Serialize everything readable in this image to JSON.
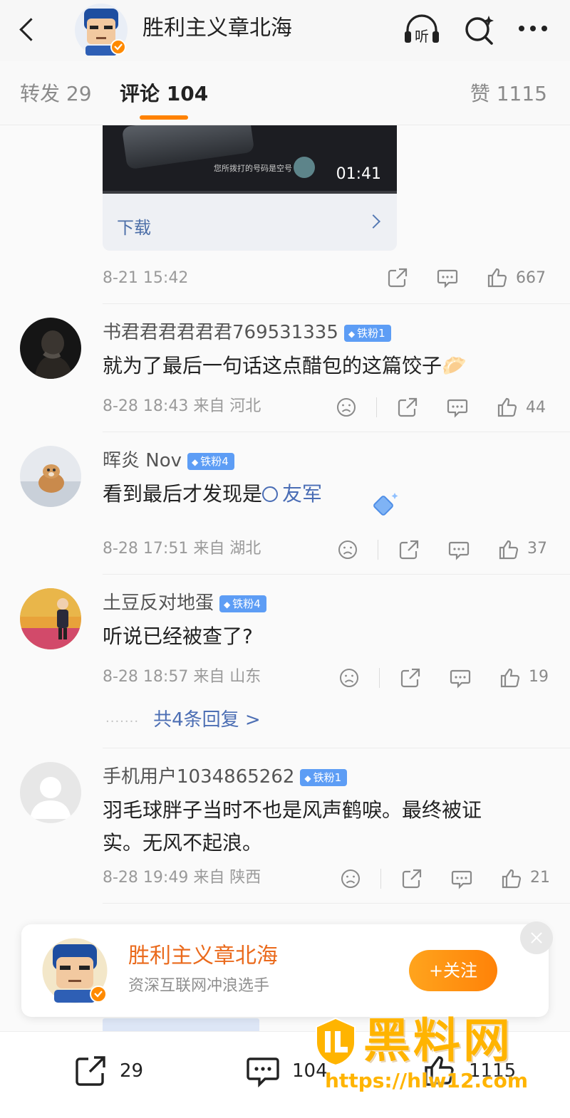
{
  "header": {
    "title": "胜利主义章北海",
    "icons": [
      "back-icon",
      "listen-icon",
      "search-icon",
      "more-icon"
    ],
    "listen_label": "听"
  },
  "tabs": {
    "repost": "转发 29",
    "comments": "评论 104",
    "likes": "赞 1115"
  },
  "colors": {
    "accent": "#ff8200",
    "link": "#4a6db5",
    "badge": "#5d9df5",
    "follow_name": "#ea6a1c"
  },
  "video": {
    "subtitle": "您所拨打的号码是空号",
    "duration": "01:41",
    "download_label": "下载"
  },
  "post_meta": {
    "time": "8-21 15:42",
    "likes": "667"
  },
  "comments": [
    {
      "name": "书君君君君君君769531335",
      "badge": "铁粉1",
      "text": "就为了最后一句话这点醋包的这篇饺子🥟",
      "meta": "8-28 18:43  来自 河北",
      "likes": "44"
    },
    {
      "name": "晖炎 Nov",
      "badge": "铁粉4",
      "text_prefix": "看到最后才发现是",
      "link": "友军",
      "meta": "8-28 17:51  来自 湖北",
      "likes": "37"
    },
    {
      "name": "土豆反对地蛋",
      "badge": "铁粉4",
      "text": "听说已经被查了?",
      "meta": "8-28 18:57  来自 山东",
      "likes": "19",
      "replies": "共4条回复 >"
    },
    {
      "name": "手机用户1034865262",
      "badge": "铁粉1",
      "text_line1": "羽毛球胖子当时不也是风声鹤唳。最终被证",
      "text_line2": "实。无风不起浪。",
      "meta": "8-28 19:49  来自 陕西",
      "likes": "21"
    }
  ],
  "follow_popup": {
    "name": "胜利主义章北海",
    "description": "资深互联网冲浪选手",
    "button": "+关注"
  },
  "bottom_bar": {
    "repost_count": "29",
    "comment_count": "104",
    "like_count": "1115"
  },
  "watermark": {
    "text": "黑料网",
    "url": "https://hlw12.com"
  }
}
